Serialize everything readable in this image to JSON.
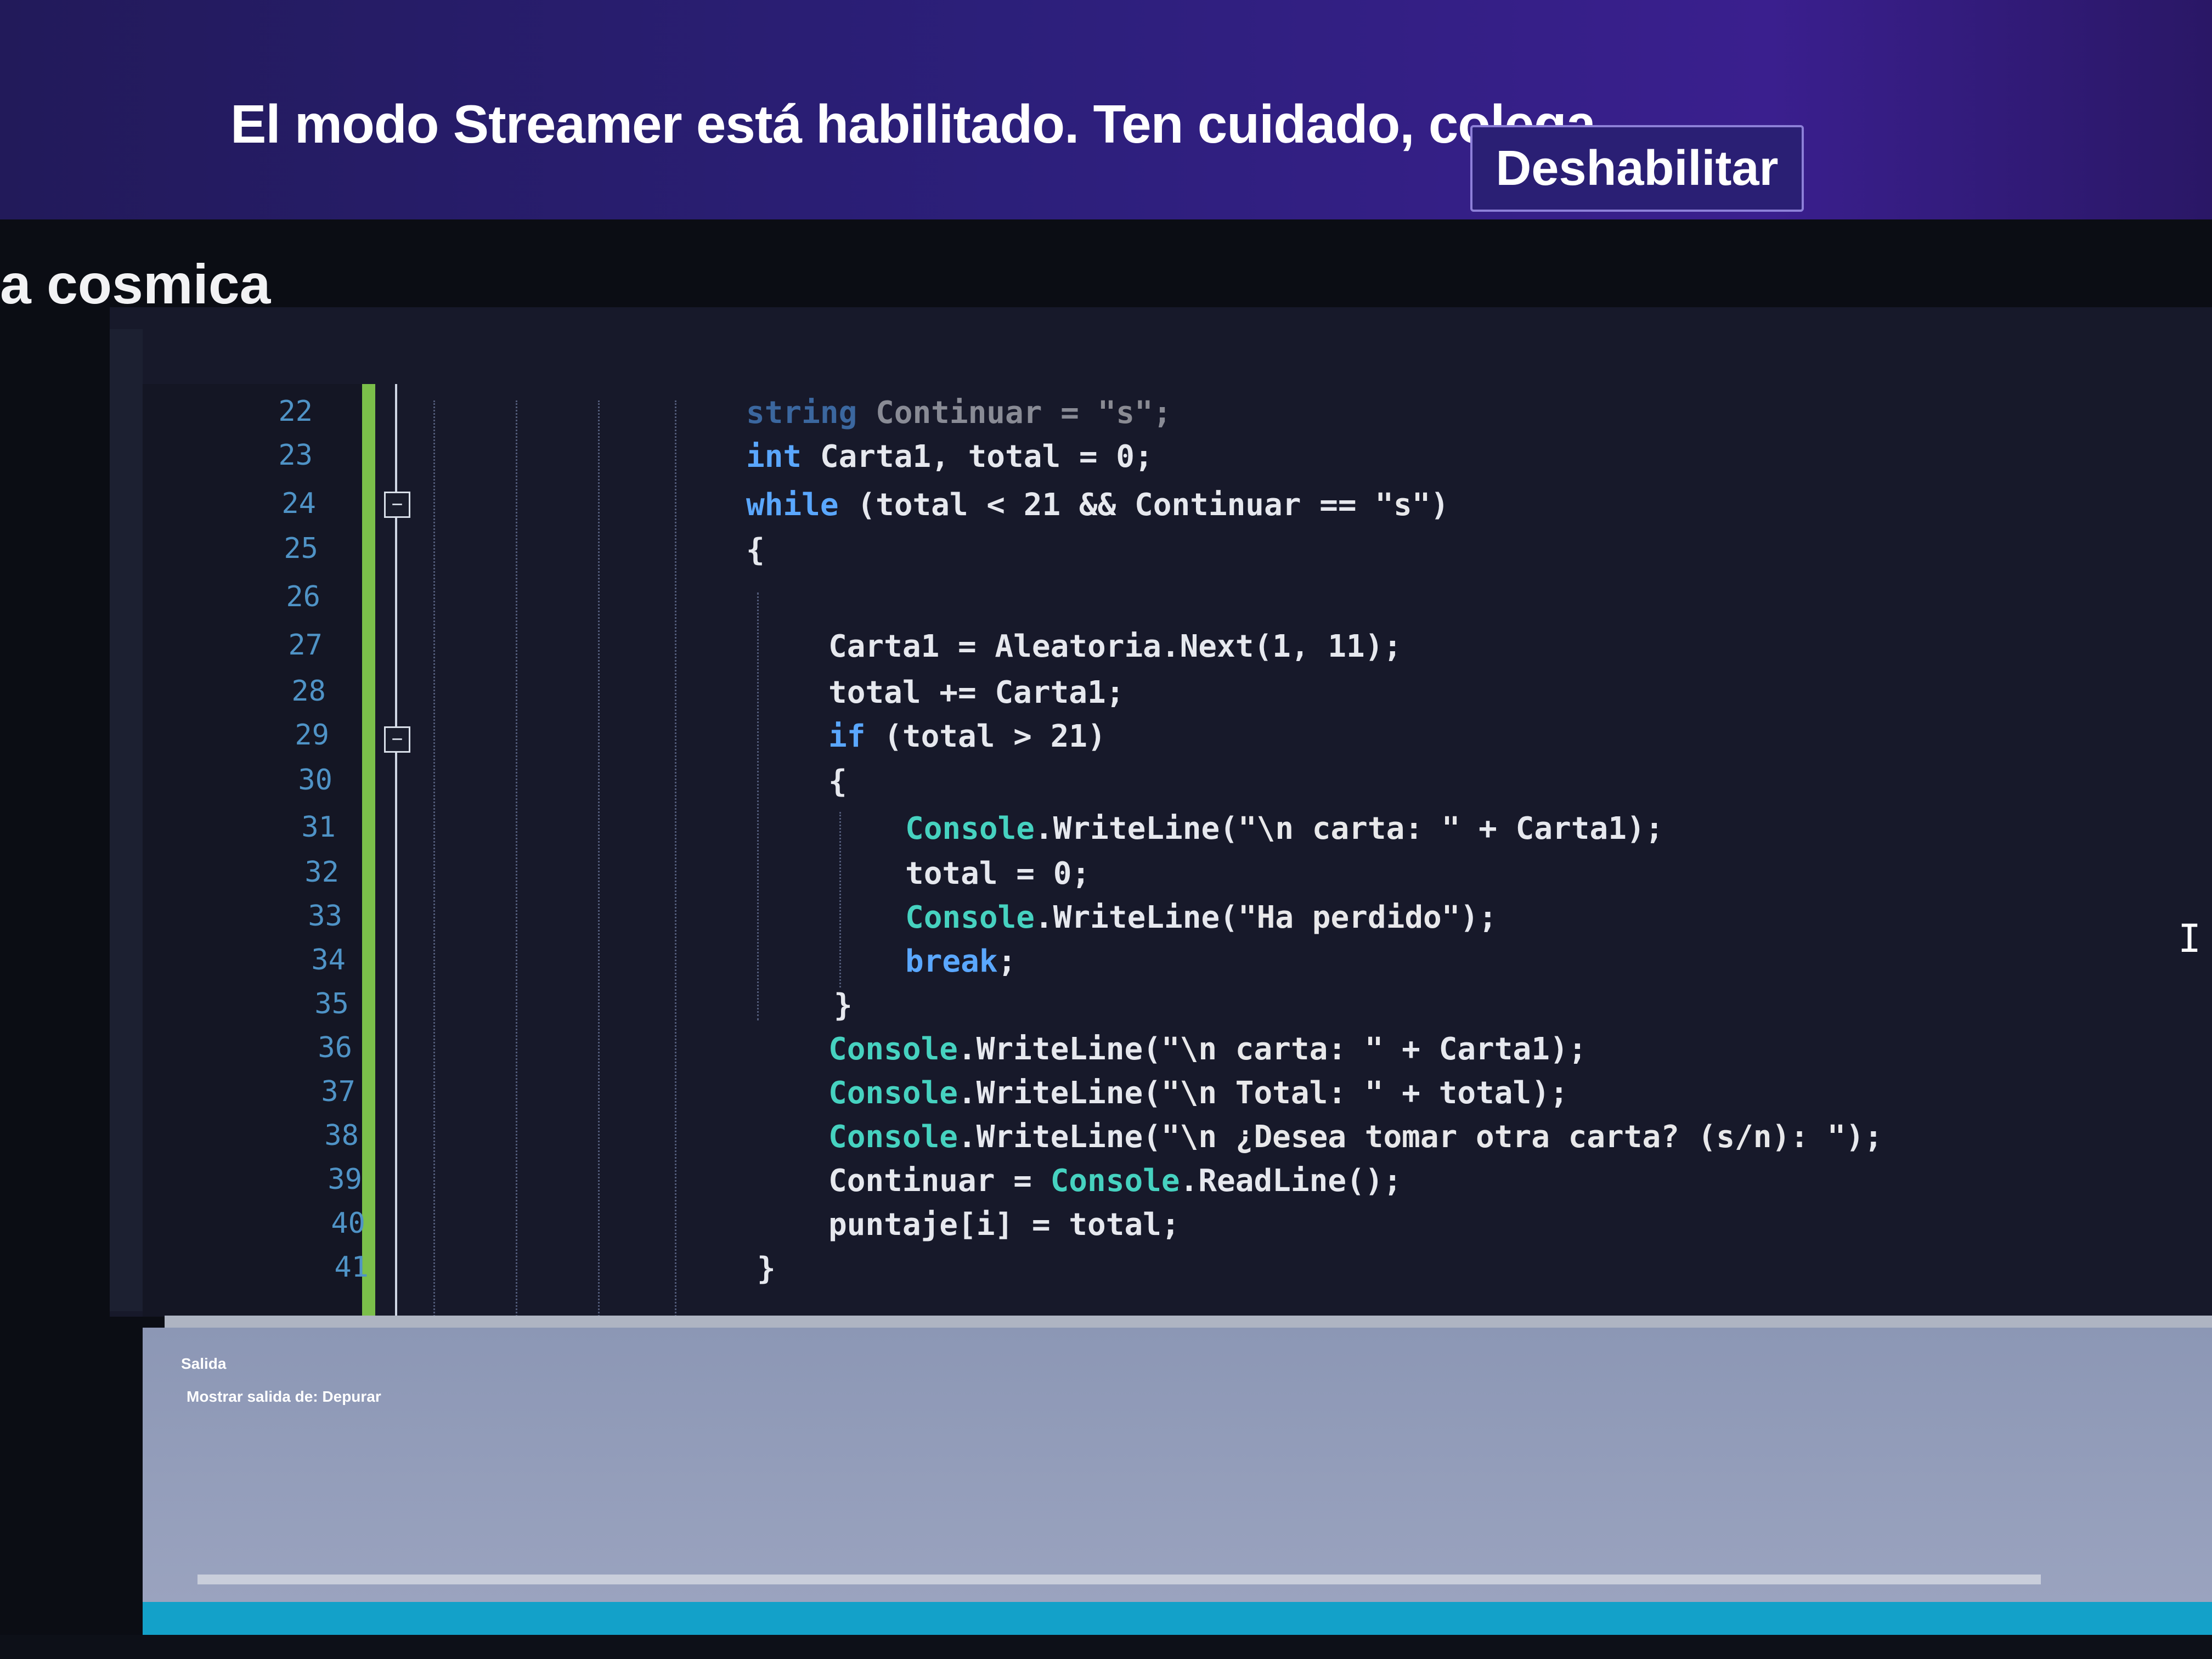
{
  "banner": {
    "message": "El modo Streamer está habilitado. Ten cuidado, colega.",
    "button": "Deshabilitar"
  },
  "window": {
    "title_fragment": "a cosmica"
  },
  "editor": {
    "line_numbers": [
      "22",
      "23",
      "24",
      "25",
      "26",
      "27",
      "28",
      "29",
      "30",
      "31",
      "32",
      "33",
      "34",
      "35",
      "36",
      "37",
      "38",
      "39",
      "40",
      "41"
    ],
    "code": [
      {
        "n": "22",
        "parts": [
          [
            "kw",
            "string"
          ],
          [
            "",
            " Continuar = "
          ],
          [
            "str",
            "\"s\""
          ],
          [
            "",
            ";"
          ]
        ]
      },
      {
        "n": "23",
        "parts": [
          [
            "kw",
            "int"
          ],
          [
            "",
            " Carta1, total = 0;"
          ]
        ]
      },
      {
        "n": "24",
        "parts": [
          [
            "kw",
            "while"
          ],
          [
            "",
            " (total < 21 && Continuar == "
          ],
          [
            "str",
            "\"s\""
          ],
          [
            "",
            ")"
          ]
        ]
      },
      {
        "n": "25",
        "parts": [
          [
            "",
            "{"
          ]
        ]
      },
      {
        "n": "26",
        "parts": []
      },
      {
        "n": "27",
        "parts": [
          [
            "",
            "Carta1 = Aleatoria.Next(1, 11);"
          ]
        ]
      },
      {
        "n": "28",
        "parts": [
          [
            "",
            "total += Carta1;"
          ]
        ]
      },
      {
        "n": "29",
        "parts": [
          [
            "kw",
            "if"
          ],
          [
            "",
            " (total > 21)"
          ]
        ]
      },
      {
        "n": "30",
        "parts": [
          [
            "",
            "{"
          ]
        ]
      },
      {
        "n": "31",
        "parts": [
          [
            "cls",
            "Console"
          ],
          [
            "",
            ".WriteLine("
          ],
          [
            "str",
            "\"\\n carta: \""
          ],
          [
            "",
            " + Carta1);"
          ]
        ]
      },
      {
        "n": "32",
        "parts": [
          [
            "",
            "total = 0;"
          ]
        ]
      },
      {
        "n": "33",
        "parts": [
          [
            "cls",
            "Console"
          ],
          [
            "",
            ".WriteLine("
          ],
          [
            "str",
            "\"Ha perdido\""
          ],
          [
            "",
            ");"
          ]
        ]
      },
      {
        "n": "34",
        "parts": [
          [
            "kw",
            "break"
          ],
          [
            "",
            ";"
          ]
        ]
      },
      {
        "n": "35",
        "parts": [
          [
            "",
            "}"
          ]
        ]
      },
      {
        "n": "36",
        "parts": [
          [
            "cls",
            "Console"
          ],
          [
            "",
            ".WriteLine("
          ],
          [
            "str",
            "\"\\n carta: \""
          ],
          [
            "",
            " + Carta1);"
          ]
        ]
      },
      {
        "n": "37",
        "parts": [
          [
            "cls",
            "Console"
          ],
          [
            "",
            ".WriteLine("
          ],
          [
            "str",
            "\"\\n Total: \""
          ],
          [
            "",
            " + total);"
          ]
        ]
      },
      {
        "n": "38",
        "parts": [
          [
            "cls",
            "Console"
          ],
          [
            "",
            ".WriteLine("
          ],
          [
            "str",
            "\"\\n ¿Desea tomar otra carta? (s/n): \""
          ],
          [
            "",
            ");"
          ]
        ]
      },
      {
        "n": "39",
        "parts": [
          [
            "",
            "Continuar = "
          ],
          [
            "cls",
            "Console"
          ],
          [
            "",
            ".ReadLine();"
          ]
        ]
      },
      {
        "n": "40",
        "parts": [
          [
            "",
            "puntaje[i] = total;"
          ]
        ]
      },
      {
        "n": "41",
        "parts": [
          [
            "",
            "}"
          ]
        ]
      }
    ]
  },
  "output_panel": {
    "title": "Salida",
    "show_from": "Mostrar salida de:  Depurar"
  },
  "colors": {
    "banner_bg": "#2c1f7a",
    "keyword": "#5aa7ff",
    "class_name": "#46d2c0",
    "change_bar": "#7bbf4a",
    "status_bar": "#13a1c9"
  },
  "icons": [
    "fold-minus-icon",
    "text-cursor-icon"
  ]
}
